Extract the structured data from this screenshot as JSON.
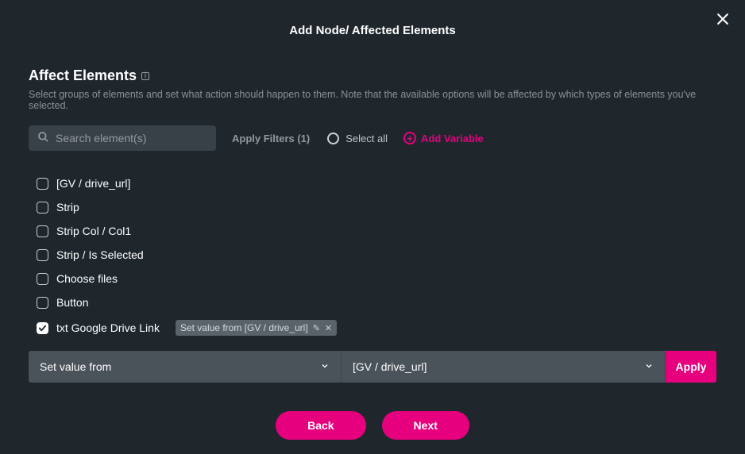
{
  "header": {
    "title": "Add Node/ Affected Elements"
  },
  "section": {
    "title": "Affect Elements",
    "desc": "Select groups of elements and set what action should happen to them. Note that the available options will be affected by which types of elements you've selected."
  },
  "search": {
    "placeholder": "Search element(s)"
  },
  "apply_filters_label": "Apply Filters (1)",
  "select_all_label": "Select all",
  "add_variable_label": "Add Variable",
  "elements": [
    {
      "label": "[GV / drive_url]",
      "checked": false
    },
    {
      "label": "Strip",
      "checked": false
    },
    {
      "label": "Strip Col / Col1",
      "checked": false
    },
    {
      "label": "Strip / Is Selected",
      "checked": false
    },
    {
      "label": "Choose files",
      "checked": false
    },
    {
      "label": "Button",
      "checked": false
    },
    {
      "label": "txt Google Drive Link",
      "checked": true
    }
  ],
  "selected_pill": {
    "text": "Set value from [GV / drive_url]"
  },
  "action_row": {
    "action_label": "Set value from",
    "value_label": "[GV / drive_url]",
    "apply_label": "Apply"
  },
  "footer": {
    "back": "Back",
    "next": "Next"
  }
}
